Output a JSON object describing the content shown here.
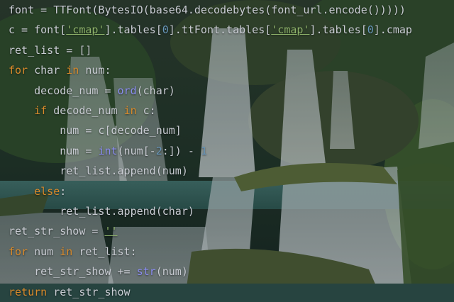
{
  "colors": {
    "default_text": "#c9ccd3",
    "keyword": "#d98a2b",
    "string": "#8fb36b",
    "number": "#6897bb",
    "builtin": "#8a8cf0"
  },
  "code": {
    "lines": [
      [
        {
          "t": "font = TTFont(BytesIO(base64.decodebytes(font_url.encode()))))",
          "k": "def"
        }
      ],
      [
        {
          "t": "c = font[",
          "k": "def"
        },
        {
          "t": "'cmap'",
          "k": "str"
        },
        {
          "t": "].tables[",
          "k": "def"
        },
        {
          "t": "0",
          "k": "num"
        },
        {
          "t": "].ttFont.tables[",
          "k": "def"
        },
        {
          "t": "'cmap'",
          "k": "str"
        },
        {
          "t": "].tables[",
          "k": "def"
        },
        {
          "t": "0",
          "k": "num"
        },
        {
          "t": "].cmap",
          "k": "def"
        }
      ],
      [
        {
          "t": "ret_list = []",
          "k": "def"
        }
      ],
      [
        {
          "t": "for",
          "k": "kw"
        },
        {
          "t": " char ",
          "k": "def"
        },
        {
          "t": "in",
          "k": "kw"
        },
        {
          "t": " num:",
          "k": "def"
        }
      ],
      [
        {
          "t": "    decode_num = ",
          "k": "def"
        },
        {
          "t": "ord",
          "k": "builtin"
        },
        {
          "t": "(char)",
          "k": "def"
        }
      ],
      [
        {
          "t": "    ",
          "k": "def"
        },
        {
          "t": "if",
          "k": "kw"
        },
        {
          "t": " decode_num ",
          "k": "def"
        },
        {
          "t": "in",
          "k": "kw"
        },
        {
          "t": " c:",
          "k": "def"
        }
      ],
      [
        {
          "t": "        num = c[decode_num]",
          "k": "def"
        }
      ],
      [
        {
          "t": "        num = ",
          "k": "def"
        },
        {
          "t": "int",
          "k": "builtin"
        },
        {
          "t": "(num[-",
          "k": "def"
        },
        {
          "t": "2",
          "k": "num"
        },
        {
          "t": ":]) - ",
          "k": "def"
        },
        {
          "t": "1",
          "k": "num"
        }
      ],
      [
        {
          "t": "        ret_list.append(num)",
          "k": "def"
        }
      ],
      [
        {
          "t": "    ",
          "k": "def"
        },
        {
          "t": "else",
          "k": "kw"
        },
        {
          "t": ":",
          "k": "def"
        }
      ],
      [
        {
          "t": "        ret_list.append(char)",
          "k": "def"
        }
      ],
      [
        {
          "t": "ret_str_show = ",
          "k": "def"
        },
        {
          "t": "''",
          "k": "str"
        }
      ],
      [
        {
          "t": "for",
          "k": "kw"
        },
        {
          "t": " num ",
          "k": "def"
        },
        {
          "t": "in",
          "k": "kw"
        },
        {
          "t": " ret_list:",
          "k": "def"
        }
      ],
      [
        {
          "t": "    ret_str_show += ",
          "k": "def"
        },
        {
          "t": "str",
          "k": "builtin"
        },
        {
          "t": "(num)",
          "k": "def"
        }
      ],
      [
        {
          "t": "return",
          "k": "kw"
        },
        {
          "t": " ret_str_show",
          "k": "def"
        }
      ]
    ]
  }
}
